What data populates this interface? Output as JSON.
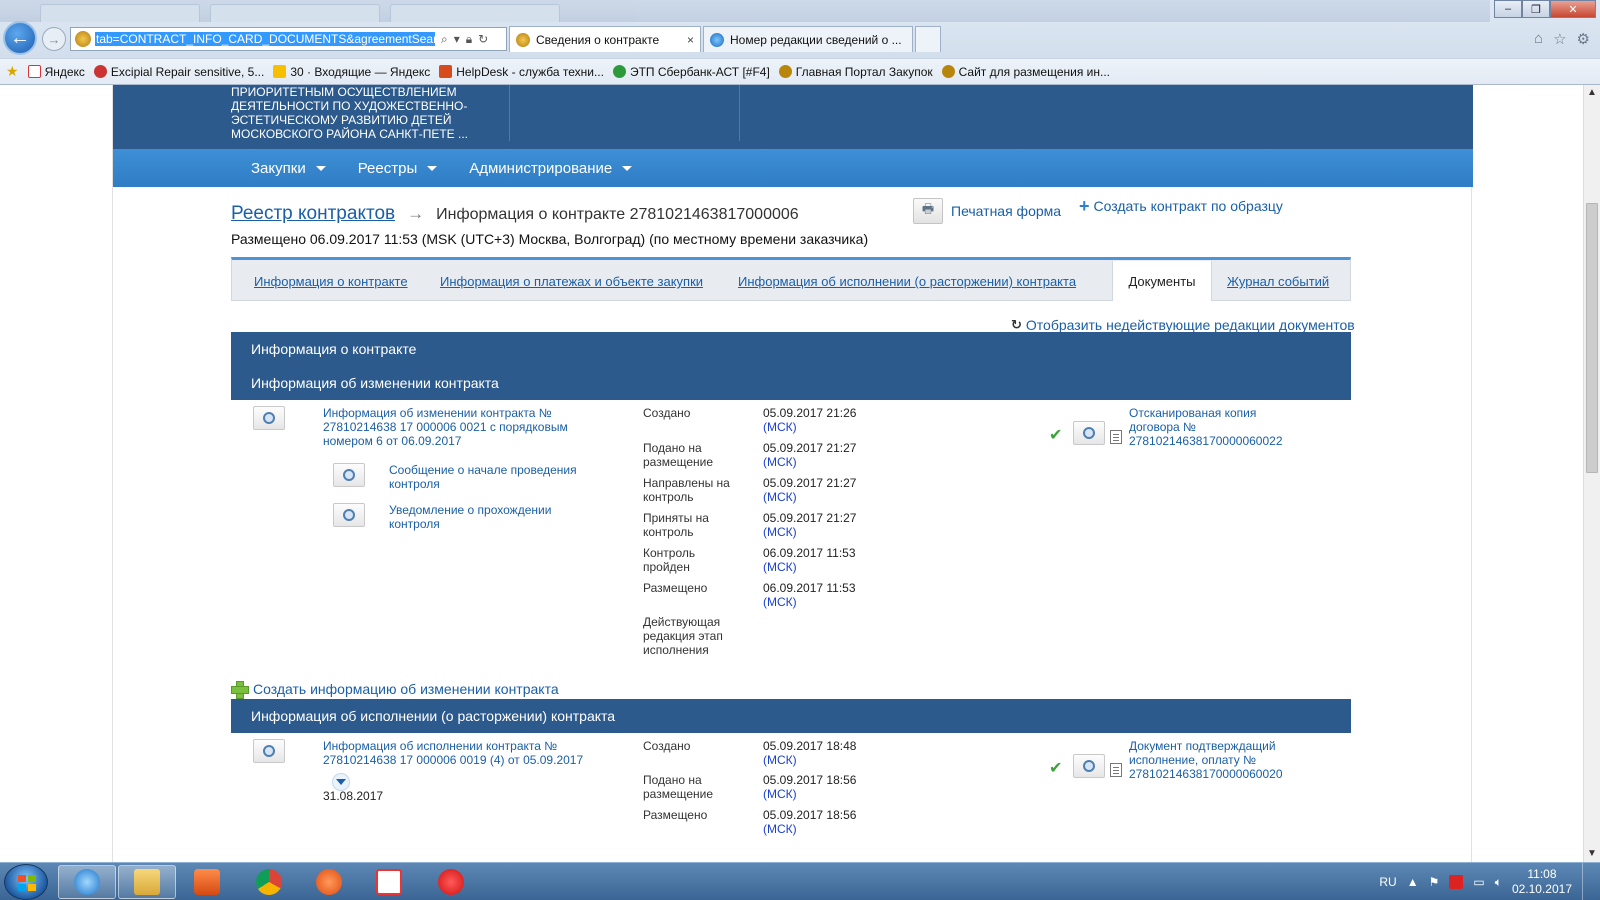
{
  "browser": {
    "address": "tab=CONTRACT_INFO_CARD_DOCUMENTS&agreementSearch=",
    "tabs": [
      {
        "label": "Сведения о контракте",
        "close": "×"
      },
      {
        "label": "Номер редакции сведений о ..."
      }
    ],
    "window_controls": {
      "min": "–",
      "max": "❐",
      "close": "✕"
    },
    "favorites": [
      {
        "label": "Яндекс"
      },
      {
        "label": "Excipial Repair sensitive, 5..."
      },
      {
        "label": "30 · Входящие — Яндекс"
      },
      {
        "label": "HelpDesk - служба техни..."
      },
      {
        "label": "ЭТП Сбербанк-АСТ [#F4]"
      },
      {
        "label": "Главная Портал Закупок"
      },
      {
        "label": "Сайт для размещения ин..."
      }
    ]
  },
  "site": {
    "org_name": "ПРИОРИТЕТНЫМ ОСУЩЕСТВЛЕНИЕМ ДЕЯТЕЛЬНОСТИ ПО ХУДОЖЕСТВЕННО-ЭСТЕТИЧЕСКОМУ РАЗВИТИЮ ДЕТЕЙ МОСКОВСКОГО РАЙОНА САНКТ-ПЕТЕ ...",
    "nav": [
      "Закупки",
      "Реестры",
      "Администрирование"
    ]
  },
  "page": {
    "breadcrumb_link": "Реестр контрактов",
    "breadcrumb_arrow": "→",
    "breadcrumb_current": "Информация о контракте 2781021463817000006",
    "published": "Размещено 06.09.2017 11:53 (MSK (UTC+3) Москва, Волгоград) (по местному времени заказчика)",
    "print_form": "Печатная форма",
    "create_by_sample": "Создать контракт по образцу",
    "tabs": [
      "Информация о контракте",
      "Информация о платежах и объекте закупки",
      "Информация об исполнении (о расторжении) контракта",
      "Документы",
      "Журнал событий"
    ],
    "show_invalid": "Отобразить недействующие редакции документов",
    "sections": {
      "contract_info": "Информация о контракте",
      "change_info": "Информация об изменении контракта",
      "execution_info": "Информация об исполнении (о расторжении) контракта"
    },
    "change": {
      "main_doc": "Информация об изменении контракта № 27810214638 17 000006 0021 с порядковым номером 6 от 06.09.2017",
      "sub_docs": [
        "Сообщение о начале проведения контроля",
        "Уведомление о прохождении контроля"
      ],
      "events": [
        {
          "label": "Создано",
          "date": "05.09.2017 21:26",
          "tz": "(МСК)"
        },
        {
          "label": "Подано на размещение",
          "date": "05.09.2017 21:27",
          "tz": "(МСК)"
        },
        {
          "label": "Направлены на контроль",
          "date": "05.09.2017 21:27",
          "tz": "(МСК)"
        },
        {
          "label": "Приняты на контроль",
          "date": "05.09.2017 21:27",
          "tz": "(МСК)"
        },
        {
          "label": "Контроль пройден",
          "date": "06.09.2017 11:53",
          "tz": "(МСК)"
        },
        {
          "label": "Размещено",
          "date": "06.09.2017 11:53",
          "tz": "(МСК)"
        }
      ],
      "status": "Действующая редакция этап исполнения",
      "attachment": "Отсканированая копия договора № 27810214638170000060022"
    },
    "create_change_link": "Создать информацию об изменении контракта",
    "execution": {
      "main_doc": "Информация об исполнении контракта № 27810214638 17 000006 0019 (4) от 05.09.2017",
      "date": "31.08.2017",
      "events": [
        {
          "label": "Создано",
          "date": "05.09.2017 18:48",
          "tz": "(МСК)"
        },
        {
          "label": "Подано на размещение",
          "date": "05.09.2017 18:56",
          "tz": "(МСК)"
        },
        {
          "label": "Размещено",
          "date": "05.09.2017 18:56",
          "tz": "(МСК)"
        }
      ],
      "attachment": "Документ подтверждащий исполнение, оплату № 27810214638170000060020"
    }
  },
  "taskbar": {
    "lang": "RU",
    "time": "11:08",
    "date": "02.10.2017"
  },
  "colors": {
    "header": "#2c5a8c",
    "nav": "#3e8fd6",
    "link": "#1a5fa7"
  }
}
